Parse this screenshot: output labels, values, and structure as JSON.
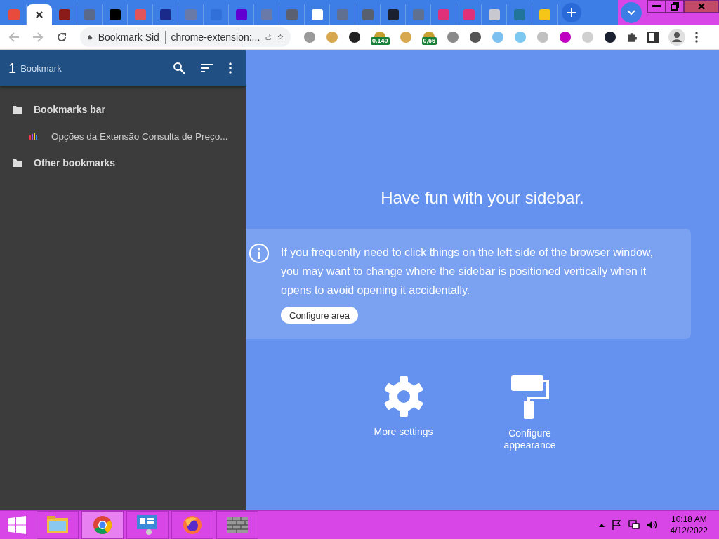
{
  "tabs": [
    {
      "selected": false,
      "color": "#e84a3c"
    },
    {
      "selected": true,
      "color": "#333333"
    },
    {
      "selected": false,
      "color": "#8b1a1a"
    },
    {
      "selected": false,
      "color": "#5a6a8a"
    },
    {
      "selected": false,
      "color": "#000000"
    },
    {
      "selected": false,
      "color": "#e2545a"
    },
    {
      "selected": false,
      "color": "#1a2a8a"
    },
    {
      "selected": false,
      "color": "#6a7aa8"
    },
    {
      "selected": false,
      "color": "#3070d8"
    },
    {
      "selected": false,
      "color": "#6001d2"
    },
    {
      "selected": false,
      "color": "#6a7aa8"
    },
    {
      "selected": false,
      "color": "#5a6070"
    },
    {
      "selected": false,
      "color": "#ffffff"
    },
    {
      "selected": false,
      "color": "#607090"
    },
    {
      "selected": false,
      "color": "#586070"
    },
    {
      "selected": false,
      "color": "#1a2030"
    },
    {
      "selected": false,
      "color": "#607090"
    },
    {
      "selected": false,
      "color": "#e0307a"
    },
    {
      "selected": false,
      "color": "#e0307a"
    },
    {
      "selected": false,
      "color": "#c8c8d0"
    },
    {
      "selected": false,
      "color": "#21759b"
    },
    {
      "selected": false,
      "color": "#f5c518"
    }
  ],
  "omnibox": {
    "site": "Bookmark Sid",
    "url": "chrome-extension:..."
  },
  "extensions": [
    {
      "color": "#9a9a9a"
    },
    {
      "color": "#d8a850"
    },
    {
      "color": "#222222"
    },
    {
      "color": "#c8a030",
      "badge": "0.140"
    },
    {
      "color": "#d8a850"
    },
    {
      "color": "#c8a030",
      "badge": "0,66"
    },
    {
      "color": "#8a8a8a"
    },
    {
      "color": "#555555"
    },
    {
      "color": "#7cc0f0"
    },
    {
      "color": "#7cc8f0"
    },
    {
      "color": "#c0c0c0"
    },
    {
      "color": "#c000c0"
    },
    {
      "color": "#d0d0d0"
    },
    {
      "color": "#1a2030"
    }
  ],
  "sidebar": {
    "count": "1",
    "title": "Bookmark",
    "tree": [
      {
        "label": "Bookmarks bar",
        "kind": "folder",
        "children": [
          {
            "label": "Opções da Extensão Consulta de Preço...",
            "kind": "page"
          }
        ]
      },
      {
        "label": "Other bookmarks",
        "kind": "folder"
      }
    ]
  },
  "main": {
    "heading": "Have fun with your sidebar.",
    "notice": "If you frequently need to click things on the left side of the browser window, you may want to change where the sidebar is positioned vertically when it opens to avoid opening it accidentally.",
    "notice_button": "Configure area",
    "actions": [
      {
        "kind": "gear",
        "label": "More settings"
      },
      {
        "kind": "roller",
        "label": "Configure appearance"
      }
    ]
  },
  "taskbar": {
    "apps": [
      {
        "kind": "explorer",
        "selected": false
      },
      {
        "kind": "chrome",
        "selected": true
      },
      {
        "kind": "panel",
        "selected": false
      },
      {
        "kind": "firefox",
        "selected": false
      },
      {
        "kind": "wall",
        "selected": false
      }
    ],
    "time": "10:18 AM",
    "date": "4/12/2022"
  }
}
